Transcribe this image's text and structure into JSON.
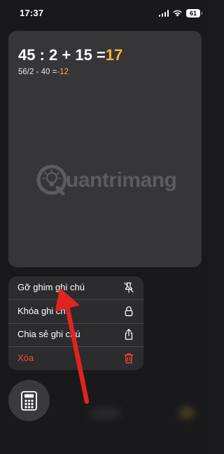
{
  "status_bar": {
    "time": "17:37",
    "battery": "61"
  },
  "note": {
    "line1": {
      "expression": "45 : 2 + 15 =",
      "result": "17"
    },
    "line2": {
      "expression": "56/2 - 40 =",
      "result": "-12"
    },
    "watermark": "uantrimang"
  },
  "context_menu": {
    "items": [
      {
        "label": "Gỡ ghim ghi chú",
        "icon": "unpin-icon"
      },
      {
        "label": "Khóa ghi chú",
        "icon": "lock-icon"
      },
      {
        "label": "Chia sẻ ghi chú",
        "icon": "share-icon"
      },
      {
        "label": "Xóa",
        "icon": "trash-icon",
        "destructive": true
      }
    ]
  },
  "calculator_button": {
    "icon": "calculator-icon"
  },
  "colors": {
    "accent": "#f4b13d",
    "destructive": "#ff453a",
    "arrow": "#e0241f",
    "card": "#363638",
    "menu": "#2c2c2e"
  }
}
